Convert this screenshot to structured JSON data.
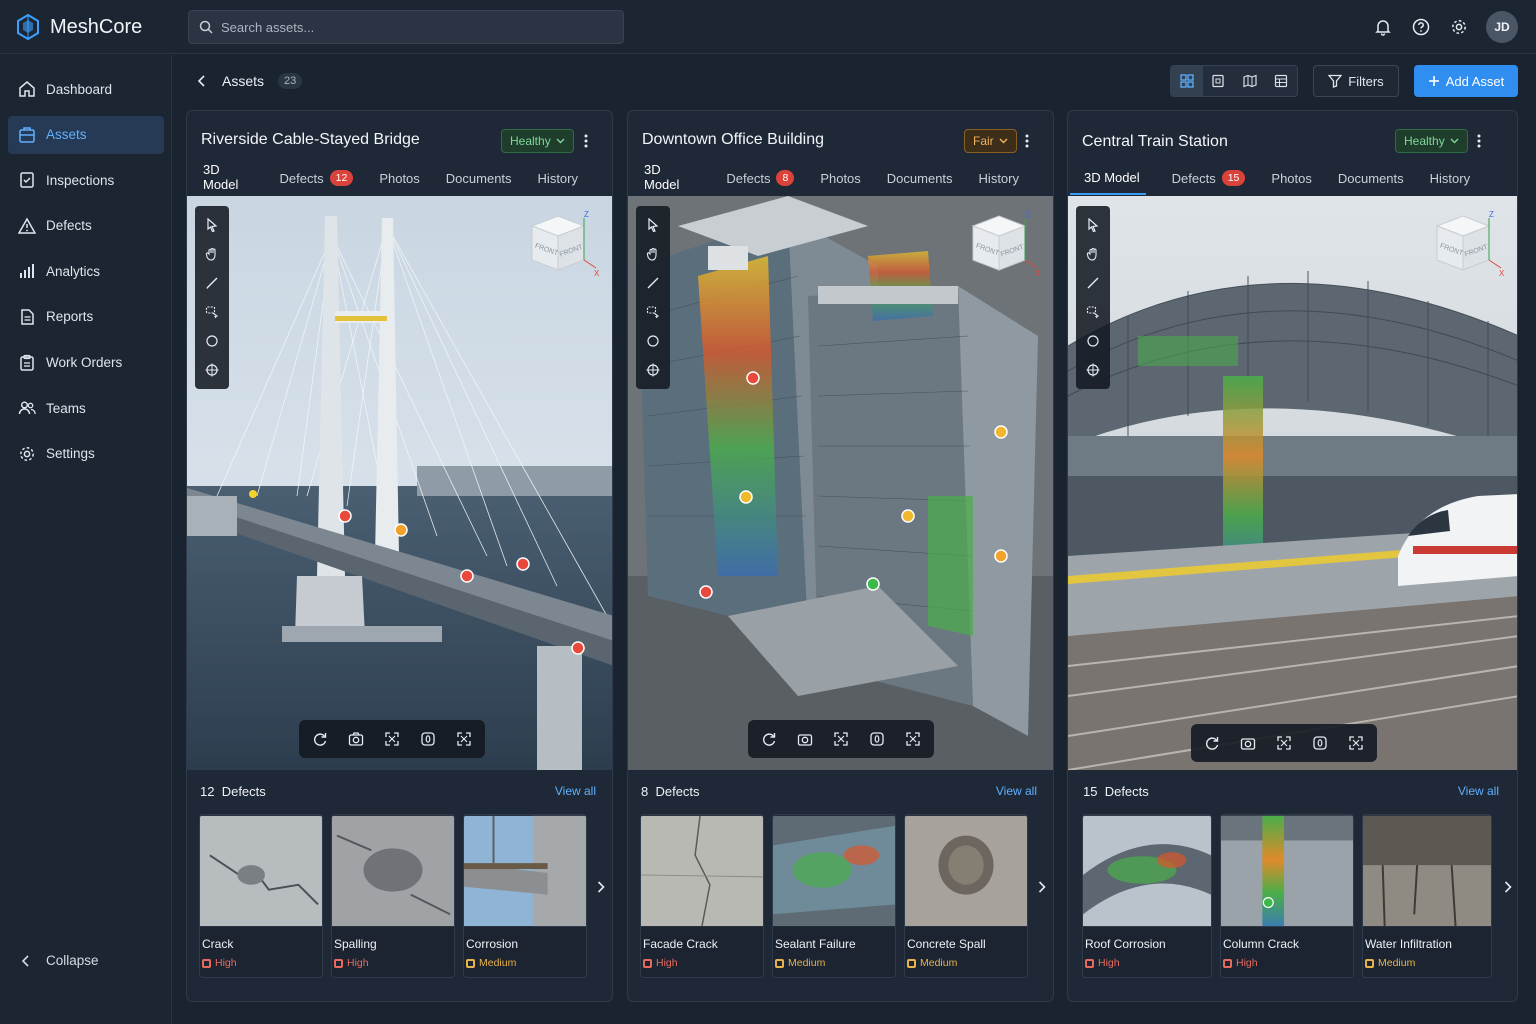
{
  "app": {
    "name": "MeshCore",
    "user_initials": "JD"
  },
  "search": {
    "placeholder": "Search assets..."
  },
  "sidebar": {
    "items": [
      {
        "label": "Dashboard",
        "icon": "home-icon",
        "active": false
      },
      {
        "label": "Assets",
        "icon": "assets-icon",
        "active": true
      },
      {
        "label": "Inspections",
        "icon": "clipboard-icon",
        "active": false
      },
      {
        "label": "Defects",
        "icon": "warning-icon",
        "active": false
      },
      {
        "label": "Analytics",
        "icon": "bar-chart-icon",
        "active": false
      },
      {
        "label": "Reports",
        "icon": "document-icon",
        "active": false
      },
      {
        "label": "Work Orders",
        "icon": "clipboard-list-icon",
        "active": false
      },
      {
        "label": "Teams",
        "icon": "users-icon",
        "active": false
      },
      {
        "label": "Settings",
        "icon": "gear-icon",
        "active": false
      }
    ],
    "collapse_label": "Collapse"
  },
  "header": {
    "title": "Assets",
    "count": "23",
    "filters_label": "Filters",
    "add_label": "Add Asset"
  },
  "tabs": [
    "3D Model",
    "Defects",
    "Photos",
    "Documents",
    "History"
  ],
  "cube": {
    "face1": "FRONT",
    "face2": "FRONT",
    "axis_x": "X",
    "axis_z": "Z"
  },
  "view_all_label": "View all",
  "defects_label": "Defects",
  "cards": [
    {
      "title": "Riverside Cable-Stayed Bridge",
      "status": "Healthy",
      "defect_count": "12",
      "defects": [
        {
          "name": "Crack",
          "severity": "High"
        },
        {
          "name": "Spalling",
          "severity": "High"
        },
        {
          "name": "Corrosion",
          "severity": "Medium"
        }
      ]
    },
    {
      "title": "Downtown Office Building",
      "status": "Fair",
      "defect_count": "8",
      "defects": [
        {
          "name": "Facade Crack",
          "severity": "High"
        },
        {
          "name": "Sealant Failure",
          "severity": "Medium"
        },
        {
          "name": "Concrete Spall",
          "severity": "Medium"
        }
      ]
    },
    {
      "title": "Central Train Station",
      "status": "Healthy",
      "defect_count": "15",
      "defects": [
        {
          "name": "Roof Corrosion",
          "severity": "High"
        },
        {
          "name": "Column Crack",
          "severity": "High"
        },
        {
          "name": "Water Infiltration",
          "severity": "Medium"
        }
      ]
    }
  ],
  "colors": {
    "accent": "#2f8ef0",
    "high": "#e86a5e",
    "medium": "#e8b34a",
    "healthy": "#7fd79b",
    "fair": "#f0b35a"
  }
}
